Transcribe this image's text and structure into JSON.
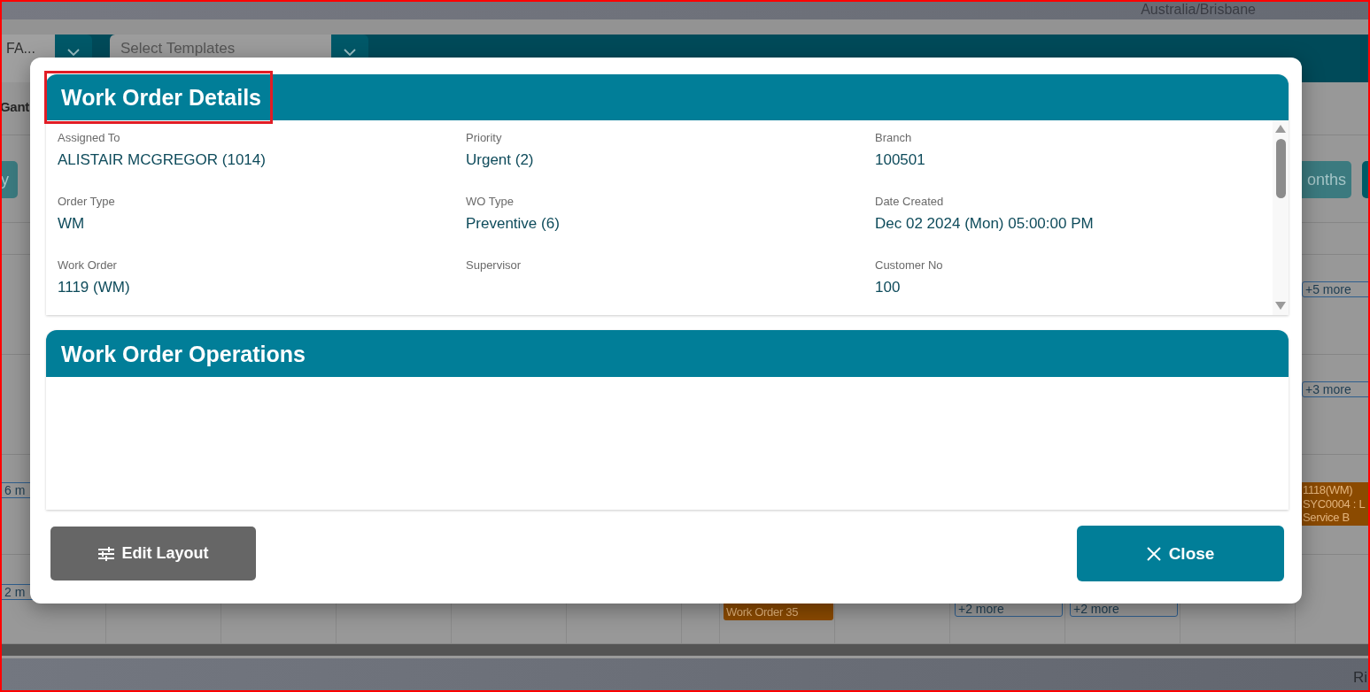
{
  "top_bar": {
    "timezone": "Australia/Brisbane"
  },
  "toolbar": {
    "fields": [
      {
        "value": "FA..."
      },
      {
        "placeholder": "Select Templates"
      }
    ]
  },
  "view_tab": {
    "label": "Gant"
  },
  "range_buttons": [
    {
      "label": "y",
      "selected": false
    },
    {
      "label": "onths",
      "selected": false
    },
    {
      "selected": true
    }
  ],
  "calendar": {
    "weeks": [
      {
        "chips": [
          {
            "kind": "more",
            "text": "+5 more"
          }
        ]
      },
      {
        "chips": [
          {
            "kind": "more",
            "text": "+3 more"
          }
        ]
      },
      {
        "chips": [
          {
            "kind": "more",
            "text": "6 m"
          },
          {
            "kind": "event",
            "lines": [
              "1118(WM)",
              "SYC0004 : L",
              "Service B"
            ]
          }
        ]
      },
      {
        "chips": [
          {
            "kind": "more",
            "text": "2 m"
          },
          {
            "kind": "event",
            "lines": [
              "Work Order 35"
            ]
          },
          {
            "kind": "more",
            "text": "+2 more"
          },
          {
            "kind": "more",
            "text": "+2 more"
          }
        ]
      }
    ]
  },
  "status_bar": {
    "text": "Ri"
  },
  "modal": {
    "sections": [
      {
        "kind": "details",
        "title": "Work Order Details",
        "highlighted": true,
        "fields": [
          {
            "label": "Assigned To",
            "value": "ALISTAIR MCGREGOR (1014)"
          },
          {
            "label": "Priority",
            "value": "Urgent (2)"
          },
          {
            "label": "Branch",
            "value": "100501"
          },
          {
            "label": "Order Type",
            "value": "WM"
          },
          {
            "label": "WO Type",
            "value": "Preventive (6)"
          },
          {
            "label": "Date Created",
            "value": "Dec 02 2024 (Mon) 05:00:00 PM"
          },
          {
            "label": "Work Order",
            "value": "1119 (WM)"
          },
          {
            "label": "Supervisor"
          },
          {
            "label": "Customer No",
            "value": "100"
          }
        ]
      },
      {
        "kind": "operations",
        "title": "Work Order Operations",
        "highlighted": false
      }
    ],
    "buttons": [
      {
        "kind": "edit",
        "label": "Edit Layout"
      },
      {
        "kind": "close",
        "label": "Close"
      }
    ]
  },
  "frame_highlighted": true
}
